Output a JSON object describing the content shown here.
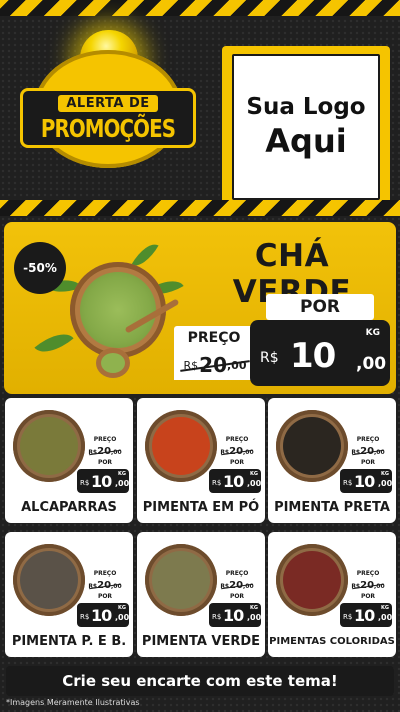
{
  "badge": {
    "line1": "ALERTA DE",
    "line2": "PROMOÇÕES"
  },
  "logo": {
    "line1": "Sua Logo",
    "line2": "Aqui"
  },
  "featured": {
    "discount": "-50%",
    "name": "CHÁ VERDE",
    "por_label": "POR",
    "preco_label": "PREÇO",
    "old_price": {
      "currency": "R$",
      "int": "20",
      "cents": ",00"
    },
    "new_price": {
      "currency": "R$",
      "int": "10",
      "cents": ",00",
      "unit": "KG"
    }
  },
  "products": [
    {
      "name": "ALCAPARRAS",
      "preco_label": "PREÇO",
      "por_label": "POR",
      "old_price": {
        "currency": "R$",
        "int": "20",
        "cents": ",00"
      },
      "new_price": {
        "currency": "R$",
        "int": "10",
        "cents": ",00",
        "unit": "KG"
      },
      "color": "#7a7a3a"
    },
    {
      "name": "PIMENTA EM PÓ",
      "preco_label": "PREÇO",
      "por_label": "POR",
      "old_price": {
        "currency": "R$",
        "int": "20",
        "cents": ",00"
      },
      "new_price": {
        "currency": "R$",
        "int": "10",
        "cents": ",00",
        "unit": "KG"
      },
      "color": "#c8431c"
    },
    {
      "name": "PIMENTA PRETA",
      "preco_label": "PREÇO",
      "por_label": "POR",
      "old_price": {
        "currency": "R$",
        "int": "20",
        "cents": ",00"
      },
      "new_price": {
        "currency": "R$",
        "int": "10",
        "cents": ",00",
        "unit": "KG"
      },
      "color": "#2b2620"
    },
    {
      "name": "PIMENTA P. E B.",
      "preco_label": "PREÇO",
      "por_label": "POR",
      "old_price": {
        "currency": "R$",
        "int": "20",
        "cents": ",00"
      },
      "new_price": {
        "currency": "R$",
        "int": "10",
        "cents": ",00",
        "unit": "KG"
      },
      "color": "#5a5248"
    },
    {
      "name": "PIMENTA VERDE",
      "preco_label": "PREÇO",
      "por_label": "POR",
      "old_price": {
        "currency": "R$",
        "int": "20",
        "cents": ",00"
      },
      "new_price": {
        "currency": "R$",
        "int": "10",
        "cents": ",00",
        "unit": "KG"
      },
      "color": "#7d7a4e"
    },
    {
      "name": "PIMENTAS COLORIDAS",
      "preco_label": "PREÇO",
      "por_label": "POR",
      "old_price": {
        "currency": "R$",
        "int": "20",
        "cents": ",00"
      },
      "new_price": {
        "currency": "R$",
        "int": "10",
        "cents": ",00",
        "unit": "KG"
      },
      "color": "#7a2a24"
    }
  ],
  "cta": "Crie seu encarte com este tema!",
  "note": "*Imagens Meramente Ilustrativas",
  "colors": {
    "accent": "#f5c400",
    "dark": "#1a1a1a"
  }
}
